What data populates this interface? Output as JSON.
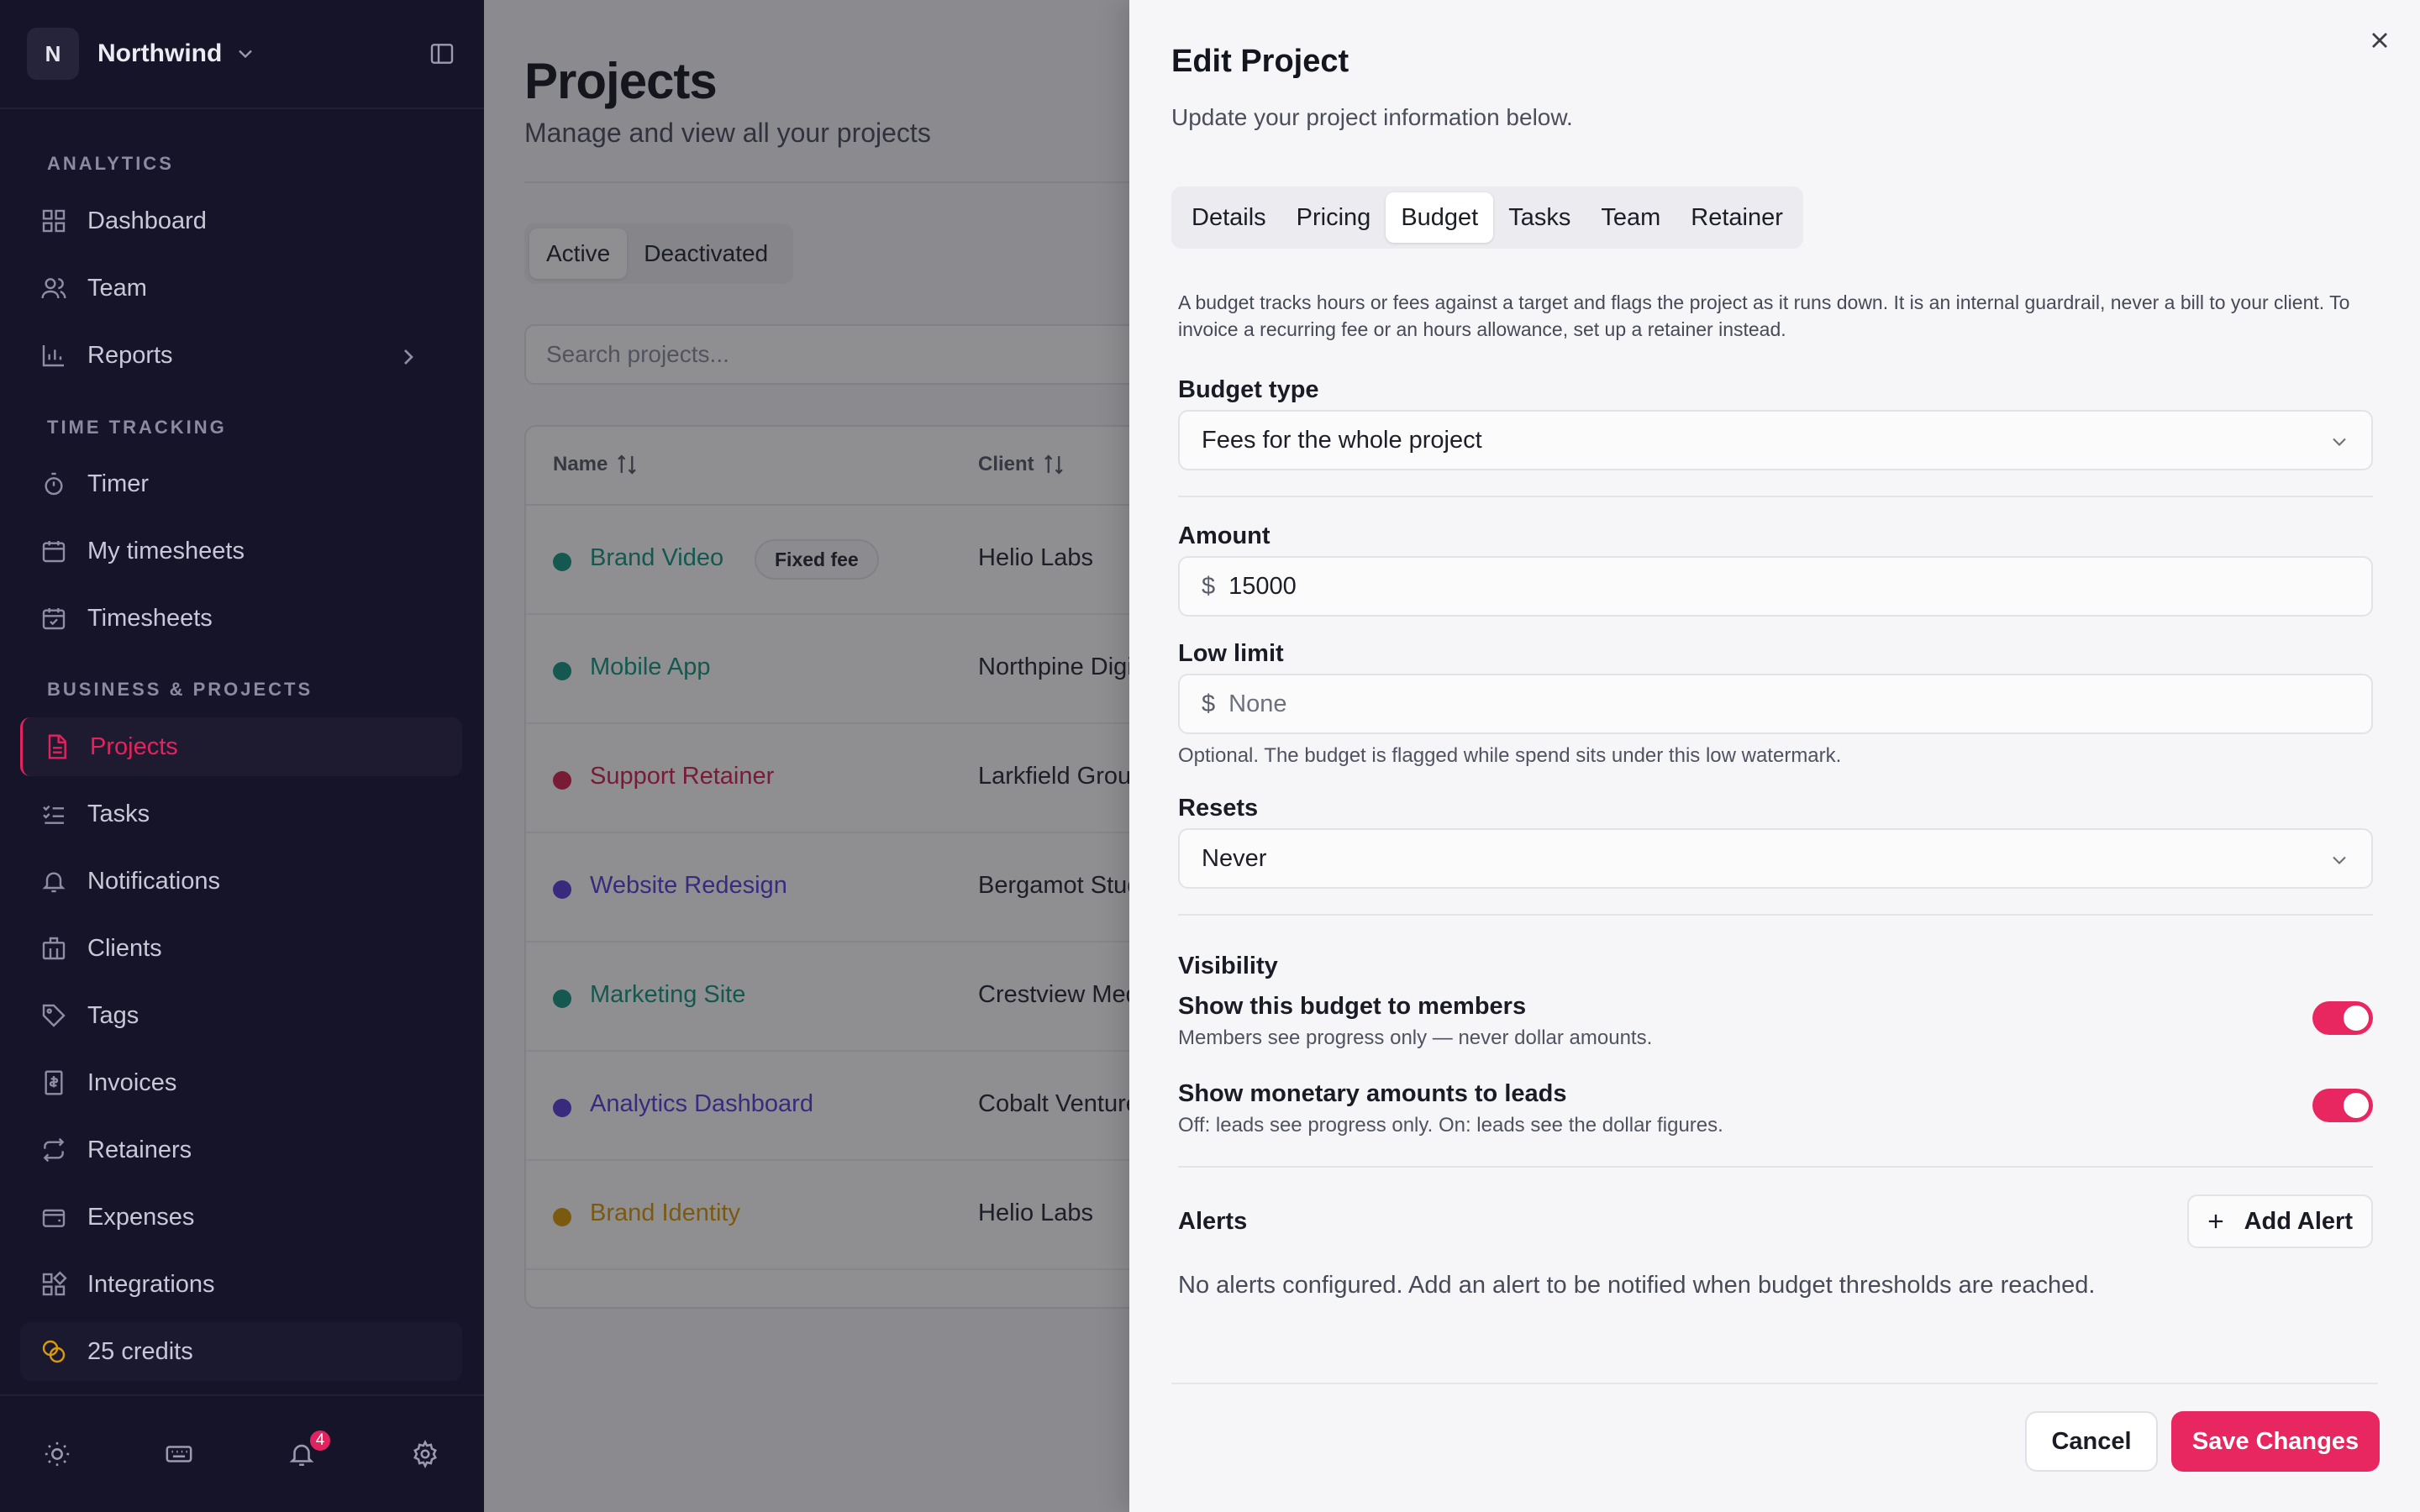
{
  "sidebar": {
    "workspace": {
      "initial": "N",
      "name": "Northwind"
    },
    "sections": {
      "analytics": "ANALYTICS",
      "time_tracking": "TIME TRACKING",
      "business": "BUSINESS & PROJECTS"
    },
    "items": {
      "dashboard": "Dashboard",
      "team": "Team",
      "reports": "Reports",
      "timer": "Timer",
      "my_timesheets": "My timesheets",
      "timesheets": "Timesheets",
      "projects": "Projects",
      "tasks": "Tasks",
      "notifications": "Notifications",
      "clients": "Clients",
      "tags": "Tags",
      "invoices": "Invoices",
      "retainers": "Retainers",
      "expenses": "Expenses",
      "integrations": "Integrations",
      "credits": "25 credits"
    },
    "notification_count": "4"
  },
  "main": {
    "title": "Projects",
    "subtitle": "Manage and view all your projects",
    "filters": {
      "active": "Active",
      "deactivated": "Deactivated"
    },
    "search_placeholder": "Search projects...",
    "columns": {
      "name": "Name",
      "client": "Client"
    },
    "rows": [
      {
        "name": "Brand Video",
        "tag": "Fixed fee",
        "client": "Helio Labs",
        "color": "#14967f"
      },
      {
        "name": "Mobile App",
        "client": "Northpine Digi",
        "color": "#14967f"
      },
      {
        "name": "Support Retainer",
        "client": "Larkfield Group",
        "color": "#d4214f"
      },
      {
        "name": "Website Redesign",
        "client": "Bergamot Stud",
        "color": "#5b3fd6"
      },
      {
        "name": "Marketing Site",
        "client": "Crestview Med",
        "color": "#14967f"
      },
      {
        "name": "Analytics Dashboard",
        "client": "Cobalt Venture",
        "color": "#5b3fd6"
      },
      {
        "name": "Brand Identity",
        "client": "Helio Labs",
        "color": "#d99a06"
      }
    ]
  },
  "panel": {
    "title": "Edit Project",
    "subtitle": "Update your project information below.",
    "tabs": [
      "Details",
      "Pricing",
      "Budget",
      "Tasks",
      "Team",
      "Retainer"
    ],
    "active_tab": "Budget",
    "description": "A budget tracks hours or fees against a target and flags the project as it runs down. It is an internal guardrail, never a bill to your client. To invoice a recurring fee or an hours allowance, set up a retainer instead.",
    "budget_type": {
      "label": "Budget type",
      "value": "Fees for the whole project"
    },
    "amount": {
      "label": "Amount",
      "currency": "$",
      "value": "15000"
    },
    "low_limit": {
      "label": "Low limit",
      "currency": "$",
      "placeholder": "None",
      "hint": "Optional. The budget is flagged while spend sits under this low watermark."
    },
    "resets": {
      "label": "Resets",
      "value": "Never"
    },
    "visibility": {
      "label": "Visibility",
      "members": {
        "title": "Show this budget to members",
        "desc": "Members see progress only — never dollar amounts.",
        "on": true
      },
      "leads": {
        "title": "Show monetary amounts to leads",
        "desc": "Off: leads see progress only. On: leads see the dollar figures.",
        "on": true
      }
    },
    "alerts": {
      "label": "Alerts",
      "add_label": "Add Alert",
      "empty": "No alerts configured. Add an alert to be notified when budget thresholds are reached."
    },
    "cancel_label": "Cancel",
    "save_label": "Save Changes"
  },
  "colors": {
    "accent": "#e8265f",
    "sidebar_bg": "#161429"
  }
}
